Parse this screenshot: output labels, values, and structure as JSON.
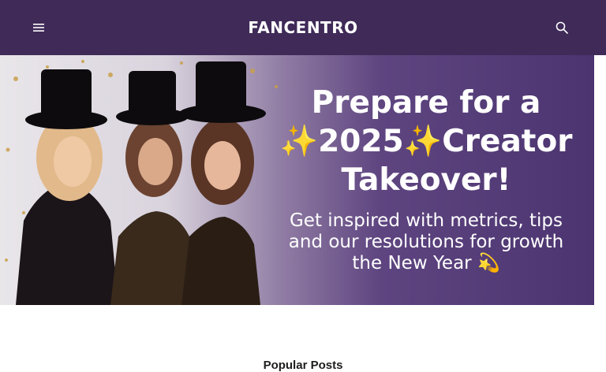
{
  "header": {
    "brand": "FANCENTRO",
    "bg_color": "#3f2a58",
    "menu_icon": "hamburger-menu-icon",
    "search_icon": "search-icon"
  },
  "hero": {
    "title_line1": "Prepare for a",
    "title_year": "2025",
    "title_line2_rest": "Creator",
    "title_line3": "Takeover!",
    "sub_line1": "Get inspired with metrics, tips",
    "sub_line2": "and our resolutions for growth",
    "sub_line3": "the New Year",
    "sparkle_icon": "sparkles-icon",
    "dizzy_icon": "dizzy-star-icon",
    "image_subject": "three-women-in-top-hats-photo"
  },
  "sections": {
    "popular_posts": "Popular Posts"
  }
}
